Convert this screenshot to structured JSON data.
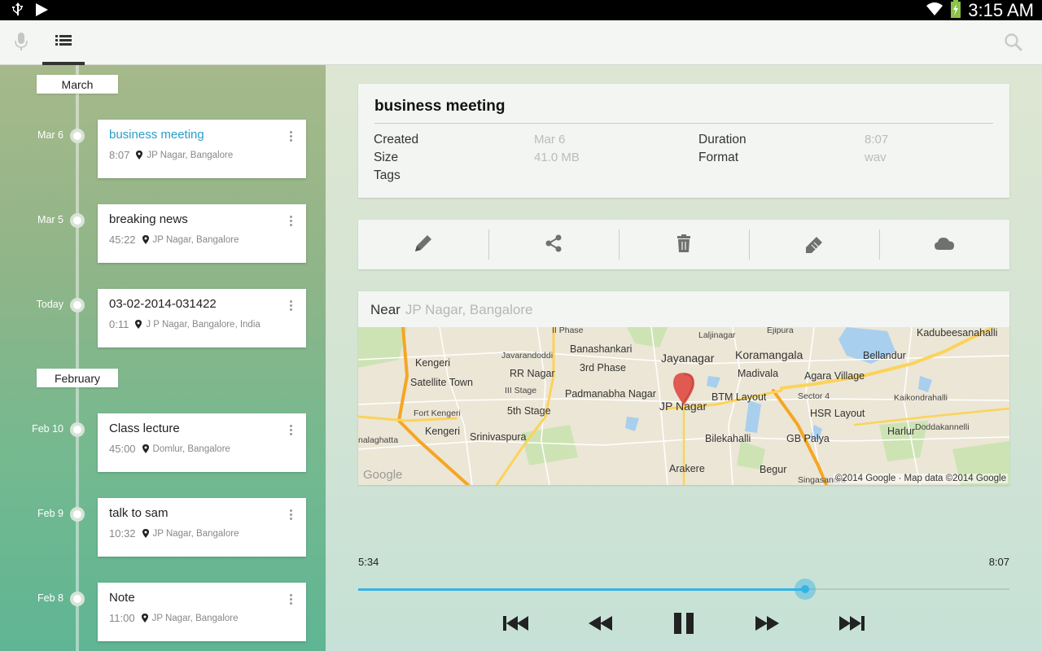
{
  "status_bar": {
    "time": "3:15 AM"
  },
  "tabs": [
    {
      "name": "record",
      "icon": "mic-icon"
    },
    {
      "name": "list",
      "icon": "list-icon",
      "selected": true
    }
  ],
  "timeline": {
    "months": [
      "March",
      "February"
    ],
    "recordings": [
      {
        "date": "Mar 6",
        "title": "business meeting",
        "duration": "8:07",
        "location": "JP Nagar, Bangalore",
        "active": true
      },
      {
        "date": "Mar 5",
        "title": "breaking news",
        "duration": "45:22",
        "location": "JP Nagar, Bangalore"
      },
      {
        "date": "Today",
        "title": "03-02-2014-031422",
        "duration": "0:11",
        "location": "J P Nagar, Bangalore, India"
      },
      {
        "date": "Feb 10",
        "title": "Class lecture",
        "duration": "45:00",
        "location": "Domlur, Bangalore"
      },
      {
        "date": "Feb 9",
        "title": "talk to sam",
        "duration": "10:32",
        "location": "JP Nagar, Bangalore"
      },
      {
        "date": "Feb 8",
        "title": "Note",
        "duration": "11:00",
        "location": "JP Nagar, Bangalore"
      }
    ]
  },
  "details": {
    "title": "business meeting",
    "created_label": "Created",
    "created": "Mar 6",
    "size_label": "Size",
    "size": "41.0 MB",
    "tags_label": "Tags",
    "duration_label": "Duration",
    "duration": "8:07",
    "format_label": "Format",
    "format": "wav"
  },
  "actions": [
    "edit-icon",
    "share-icon",
    "delete-icon",
    "tag-icon",
    "cloud-icon"
  ],
  "map": {
    "near_label": "Near",
    "near_value": "JP Nagar, Bangalore",
    "labels": {
      "phase2": "II Phase",
      "lalbagh": "Laljinagar",
      "ejipura": "Ejipura",
      "kadubeesanahalli": "Kadubeesanahalli",
      "kengeri1": "Kengeri",
      "satellite": "Satellite Town",
      "javarandoddi": "Javarandoddi",
      "banashankari": "Banashankari",
      "jayanagar": "Jayanagar",
      "koramangala": "Koramangala",
      "bellandur": "Bellandur",
      "rrnagar": "RR Nagar",
      "phase3": "3rd Phase",
      "madivala": "Madivala",
      "agara": "Agara Village",
      "stage3": "III Stage",
      "padmanabha": "Padmanabha Nagar",
      "btm": "BTM Layout",
      "sector4": "Sector 4",
      "kaikondrahalli": "Kaikondrahalli",
      "jpnagar": "JP Nagar",
      "stage5": "5th Stage",
      "hsr": "HSR Layout",
      "fortkengeri": "Fort Kengeri",
      "kengeri2": "Kengeri",
      "srinivaspura": "Srinivaspura",
      "bilekahalli": "Bilekahalli",
      "harlur": "Harlur",
      "doddakannelli": "Doddakannelli",
      "kalaghatta": "nalaghatta",
      "gbpalya": "GB Palya",
      "arakere": "Arakere",
      "begur": "Begur",
      "singasandra": "Singasandra"
    },
    "watermark": "Google",
    "copyright": "©2014 Google · Map data ©2014 Google"
  },
  "player": {
    "current": "5:34",
    "total": "8:07",
    "progress": 0.6858,
    "controls": [
      "skip-previous-icon",
      "rewind-icon",
      "pause-icon",
      "fast-forward-icon",
      "skip-next-icon"
    ]
  },
  "colors": {
    "accent": "#35b3e6",
    "active_title": "#2a9ec8",
    "pin": "#e05a52"
  }
}
